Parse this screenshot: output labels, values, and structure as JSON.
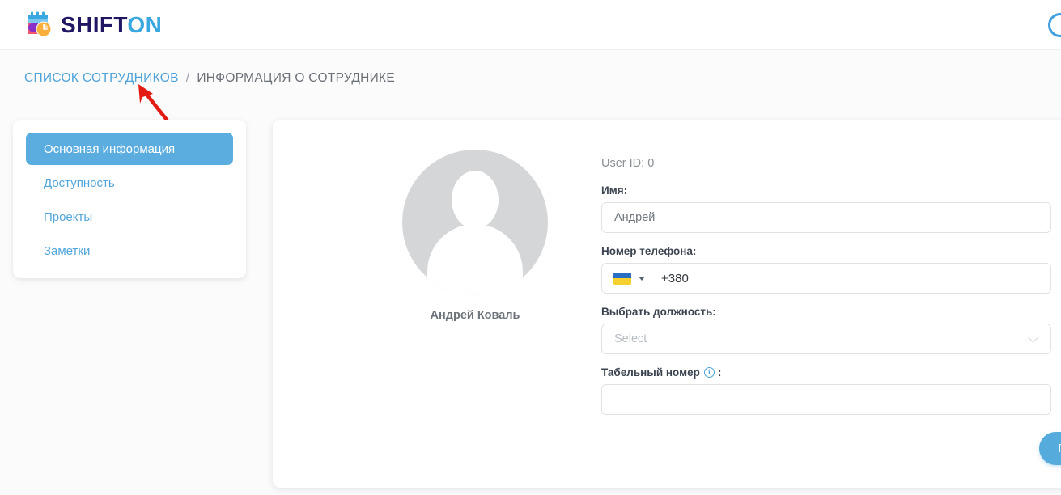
{
  "header": {
    "logo_shift": "SHIFT",
    "logo_on": "ON",
    "logo_icon": "calendar-clock-icon",
    "right_avatar_icon": "user-circle-icon"
  },
  "breadcrumb": {
    "link": "СПИСОК СОТРУДНИКОВ",
    "separator": "/",
    "current": "ИНФОРМАЦИЯ О СОТРУДНИКЕ"
  },
  "annotation": {
    "type": "arrow",
    "color": "#e31b12",
    "points_to": "СПИСОК СОТРУДНИКОВ"
  },
  "sidebar": {
    "items": [
      {
        "label": "Основная информация",
        "active": true
      },
      {
        "label": "Доступность",
        "active": false
      },
      {
        "label": "Проекты",
        "active": false
      },
      {
        "label": "Заметки",
        "active": false
      }
    ]
  },
  "profile": {
    "avatar_icon": "user-placeholder-avatar",
    "name": "Андрей Коваль"
  },
  "form": {
    "user_id": "User ID: 0",
    "name_label": "Имя:",
    "name_value": "Андрей",
    "phone_label": "Номер телефона:",
    "phone_country_icon": "ukraine-flag-icon",
    "phone_code": "+380",
    "position_label": "Выбрать должность:",
    "position_placeholder": "Select",
    "employee_number_label": "Табельный номер",
    "employee_number_info_icon": "info-icon",
    "employee_number_colon": ":",
    "employee_number_value": "",
    "invite_button": "Пригласить"
  },
  "colors": {
    "accent": "#56abdd",
    "logo_dark": "#201764",
    "logo_light": "#3aa8e0",
    "annotation_red": "#e31b12"
  }
}
